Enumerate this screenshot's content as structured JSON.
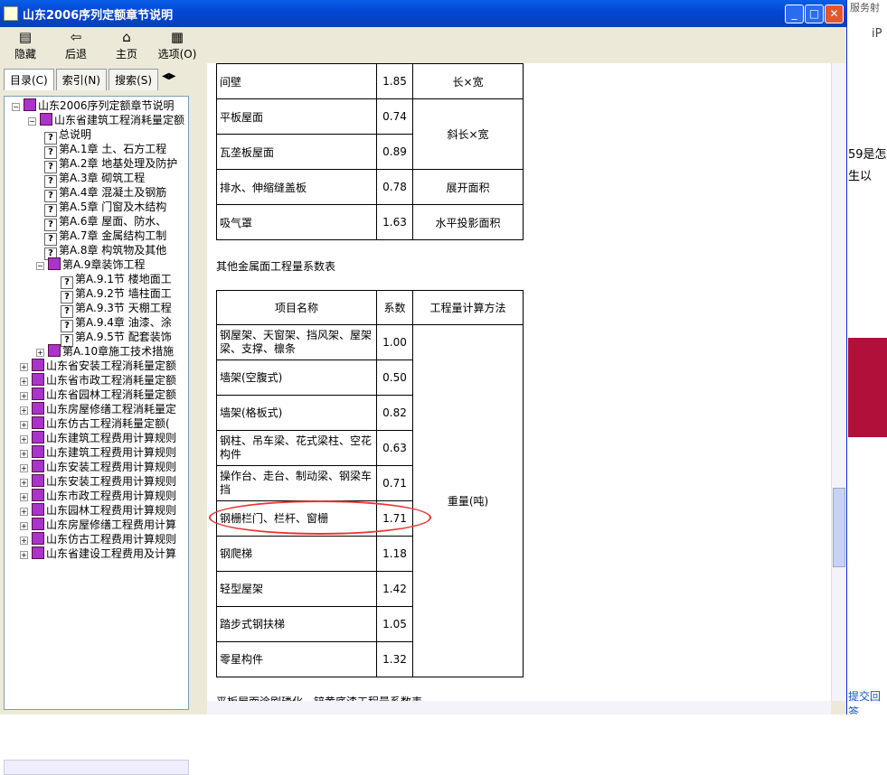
{
  "title": "山东2006序列定额章节说明",
  "toolbar": [
    {
      "g": "▤",
      "label": "隐藏"
    },
    {
      "g": "⇦",
      "label": "后退"
    },
    {
      "g": "⌂",
      "label": "主页"
    },
    {
      "g": "▦",
      "label": "选项(O)"
    }
  ],
  "tabs": [
    "目录(C)",
    "索引(N)",
    "搜索(S)"
  ],
  "tree": [
    {
      "d": 0,
      "t": "山东2006序列定额章节说明",
      "i": "book",
      "pm": "−"
    },
    {
      "d": 1,
      "t": "山东省建筑工程消耗量定额",
      "i": "book",
      "pm": "−"
    },
    {
      "d": 2,
      "t": "总说明",
      "i": "q"
    },
    {
      "d": 2,
      "t": "第A.1章 土、石方工程",
      "i": "q"
    },
    {
      "d": 2,
      "t": "第A.2章 地基处理及防护",
      "i": "q"
    },
    {
      "d": 2,
      "t": "第A.3章 砌筑工程",
      "i": "q"
    },
    {
      "d": 2,
      "t": "第A.4章 混凝土及钢筋",
      "i": "q"
    },
    {
      "d": 2,
      "t": "第A.5章 门窗及木结构",
      "i": "q"
    },
    {
      "d": 2,
      "t": "第A.6章 屋面、防水、",
      "i": "q"
    },
    {
      "d": 2,
      "t": "第A.7章 金属结构工制",
      "i": "q"
    },
    {
      "d": 2,
      "t": "第A.8章 构筑物及其他",
      "i": "q"
    },
    {
      "d": 1.5,
      "t": "第A.9章装饰工程",
      "i": "book",
      "pm": "−"
    },
    {
      "d": 3,
      "t": "第A.9.1节 楼地面工",
      "i": "q"
    },
    {
      "d": 3,
      "t": "第A.9.2节 墙柱面工",
      "i": "q"
    },
    {
      "d": 3,
      "t": "第A.9.3节 天棚工程",
      "i": "q"
    },
    {
      "d": 3,
      "t": "第A.9.4章 油漆、涂",
      "i": "q"
    },
    {
      "d": 3,
      "t": "第A.9.5节 配套装饰",
      "i": "q"
    },
    {
      "d": 1.5,
      "t": "第A.10章施工技术措施",
      "i": "book",
      "pm": "+"
    },
    {
      "d": 0.5,
      "t": "山东省安装工程消耗量定额",
      "i": "book",
      "pm": "+"
    },
    {
      "d": 0.5,
      "t": "山东省市政工程消耗量定额",
      "i": "book",
      "pm": "+"
    },
    {
      "d": 0.5,
      "t": "山东省园林工程消耗量定额",
      "i": "book",
      "pm": "+"
    },
    {
      "d": 0.5,
      "t": "山东房屋修缮工程消耗量定",
      "i": "book",
      "pm": "+"
    },
    {
      "d": 0.5,
      "t": "山东仿古工程消耗量定额(",
      "i": "book",
      "pm": "+"
    },
    {
      "d": 0.5,
      "t": "山东建筑工程费用计算规则",
      "i": "book",
      "pm": "+"
    },
    {
      "d": 0.5,
      "t": "山东建筑工程费用计算规则",
      "i": "book",
      "pm": "+"
    },
    {
      "d": 0.5,
      "t": "山东安装工程费用计算规则",
      "i": "book",
      "pm": "+"
    },
    {
      "d": 0.5,
      "t": "山东安装工程费用计算规则",
      "i": "book",
      "pm": "+"
    },
    {
      "d": 0.5,
      "t": "山东市政工程费用计算规则",
      "i": "book",
      "pm": "+"
    },
    {
      "d": 0.5,
      "t": "山东园林工程费用计算规则",
      "i": "book",
      "pm": "+"
    },
    {
      "d": 0.5,
      "t": "山东房屋修缮工程费用计算",
      "i": "book",
      "pm": "+"
    },
    {
      "d": 0.5,
      "t": "山东仿古工程费用计算规则",
      "i": "book",
      "pm": "+"
    },
    {
      "d": 0.5,
      "t": "山东省建设工程费用及计算",
      "i": "book",
      "pm": "+"
    }
  ],
  "table1": [
    [
      "间壁",
      "1.85",
      "长×宽"
    ],
    [
      "平板屋面",
      "0.74",
      "斜长×宽"
    ],
    [
      "瓦垄板屋面",
      "0.89",
      ""
    ],
    [
      "排水、伸缩缝盖板",
      "0.78",
      "展开面积"
    ],
    [
      "吸气罩",
      "1.63",
      "水平投影面积"
    ]
  ],
  "caption2": "其他金属面工程量系数表",
  "table2_head": [
    "项目名称",
    "系数",
    "工程量计算方法"
  ],
  "table2": [
    [
      "钢屋架、天窗架、挡风架、屋架梁、支撑、檩条",
      "1.00"
    ],
    [
      "墙架(空腹式)",
      "0.50"
    ],
    [
      "墙架(格板式)",
      "0.82"
    ],
    [
      "钢柱、吊车梁、花式梁柱、空花构件",
      "0.63"
    ],
    [
      "操作台、走台、制动梁、钢梁车挡",
      "0.71"
    ],
    [
      "钢栅栏门、栏杆、窗栅",
      "1.71"
    ],
    [
      "钢爬梯",
      "1.18"
    ],
    [
      "轻型屋架",
      "1.42"
    ],
    [
      "踏步式钢扶梯",
      "1.05"
    ],
    [
      "零星构件",
      "1.32"
    ]
  ],
  "table2_method": "重量(吨)",
  "caption3": "平板屋面涂刷磷化、锌黄底漆工程量系数表",
  "right": {
    "a": "服务射",
    "b": "iP",
    "c": "59是怎",
    "d": "生以",
    "e": "提交回答"
  }
}
